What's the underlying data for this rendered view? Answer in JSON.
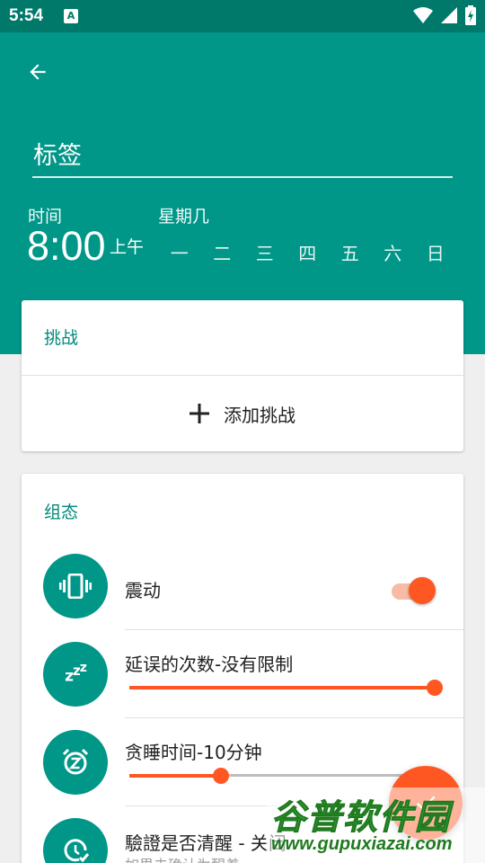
{
  "status_bar": {
    "time": "5:54",
    "notification_icon": "A"
  },
  "header": {
    "back_icon": "arrow-back-icon",
    "label_value": "标签",
    "time_caption": "时间",
    "time_value": "8:00",
    "ampm": "上午",
    "weekday_caption": "星期几",
    "days": [
      "一",
      "二",
      "三",
      "四",
      "五",
      "六",
      "日"
    ]
  },
  "challenge_card": {
    "title": "挑战",
    "add_label": "添加挑战"
  },
  "settings_card": {
    "title": "组态",
    "vibrate": {
      "label": "震动",
      "enabled": true
    },
    "snooze_count": {
      "label": "延误的次数-没有限制",
      "slider_fraction": 1.0
    },
    "snooze_time": {
      "label": "贪睡时间-10分钟",
      "slider_fraction": 0.3
    },
    "verify_awake": {
      "label": "驗證是否清醒 - 关闭",
      "sub": "如果未确认为醒着"
    }
  },
  "watermark": {
    "cn": "谷普软件园",
    "url": "www.gupuxiazai.com"
  },
  "colors": {
    "primary": "#009688",
    "status": "#00796b",
    "accent": "#ff5722"
  }
}
